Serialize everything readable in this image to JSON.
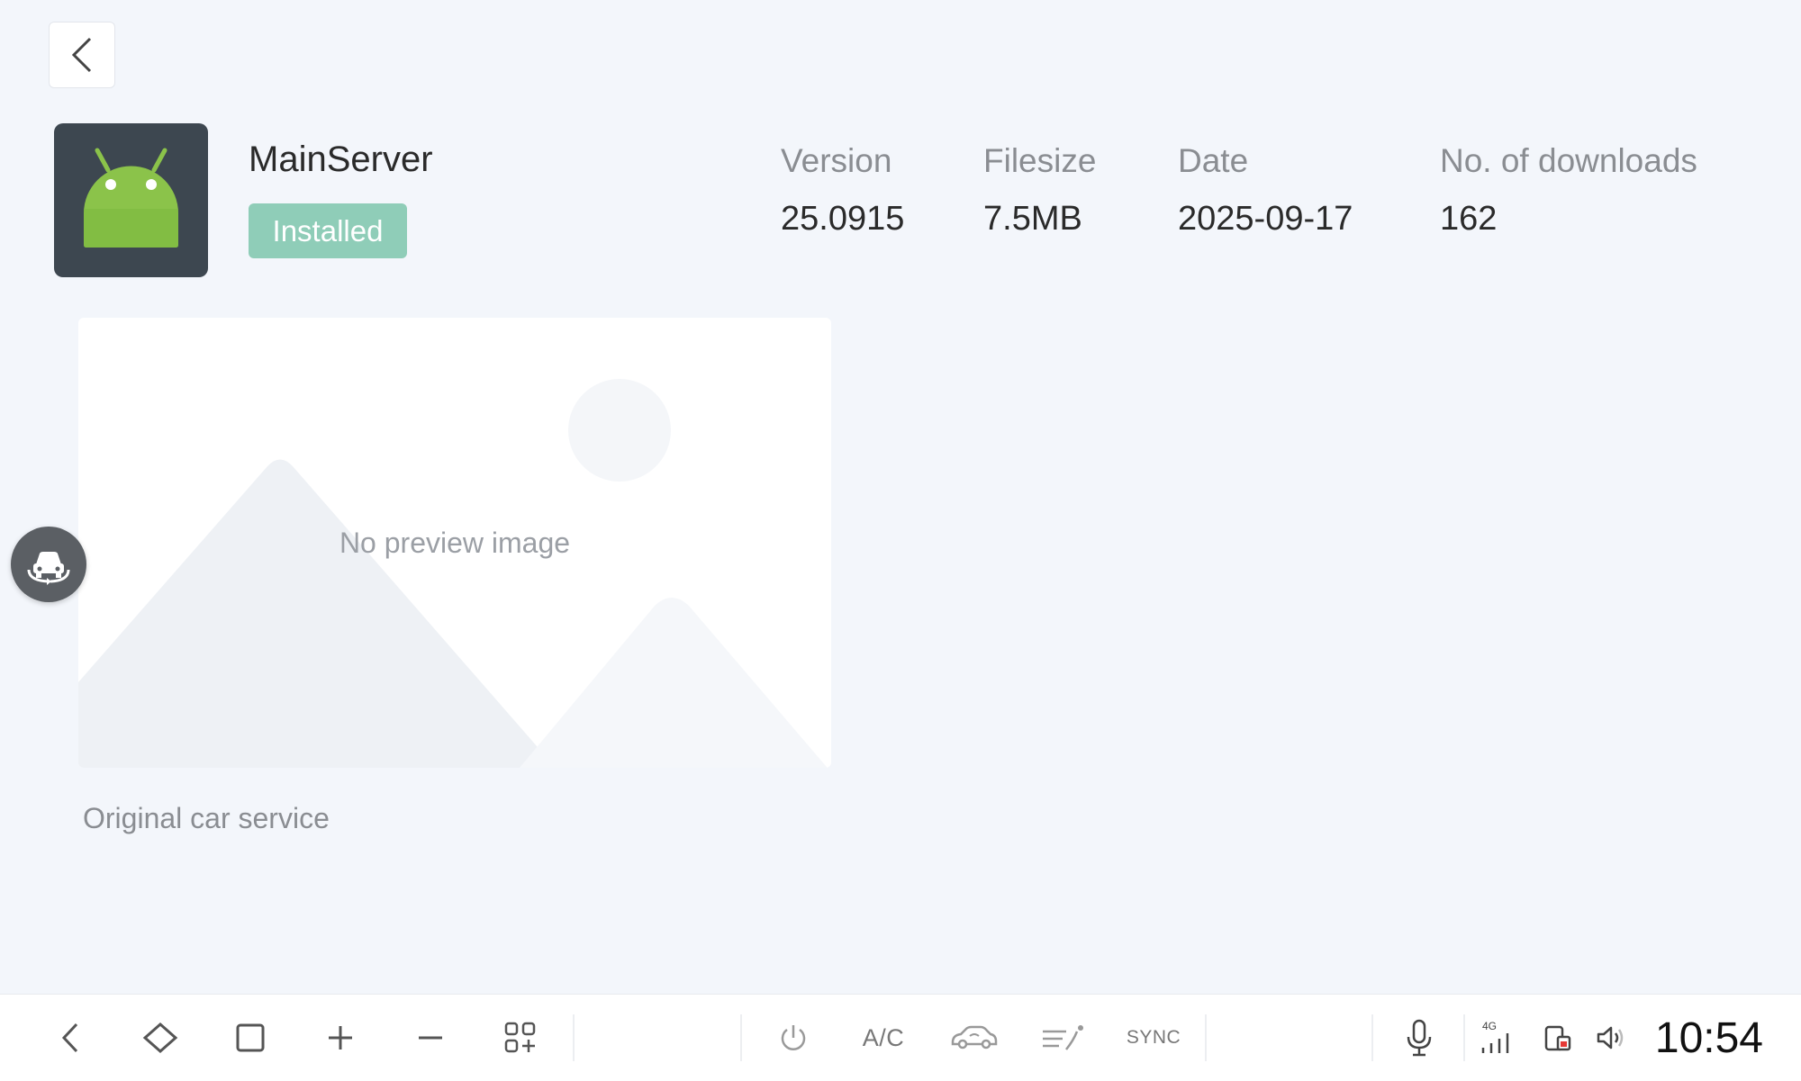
{
  "app": {
    "name": "MainServer",
    "status": "Installed",
    "description": "Original car service"
  },
  "meta": {
    "version_label": "Version",
    "version_value": "25.0915",
    "filesize_label": "Filesize",
    "filesize_value": "7.5MB",
    "date_label": "Date",
    "date_value": "2025-09-17",
    "downloads_label": "No. of downloads",
    "downloads_value": "162"
  },
  "preview": {
    "placeholder_text": "No preview image"
  },
  "taskbar": {
    "ac_label": "A/C",
    "sync_label": "SYNC",
    "signal_label": "4G",
    "clock": "10:54"
  },
  "colors": {
    "background": "#f3f6fb",
    "badge": "#8fcdb8",
    "android_green": "#8bc34a",
    "icon_bg": "#3d4750"
  },
  "icons": [
    "chevron-left-icon",
    "android-icon",
    "car-rotate-icon",
    "back-icon",
    "home-icon",
    "recent-apps-icon",
    "plus-icon",
    "minus-icon",
    "apps-add-icon",
    "power-icon",
    "car-icon",
    "airflow-icon",
    "microphone-icon",
    "signal-icon",
    "phone-battery-icon",
    "volume-icon"
  ]
}
